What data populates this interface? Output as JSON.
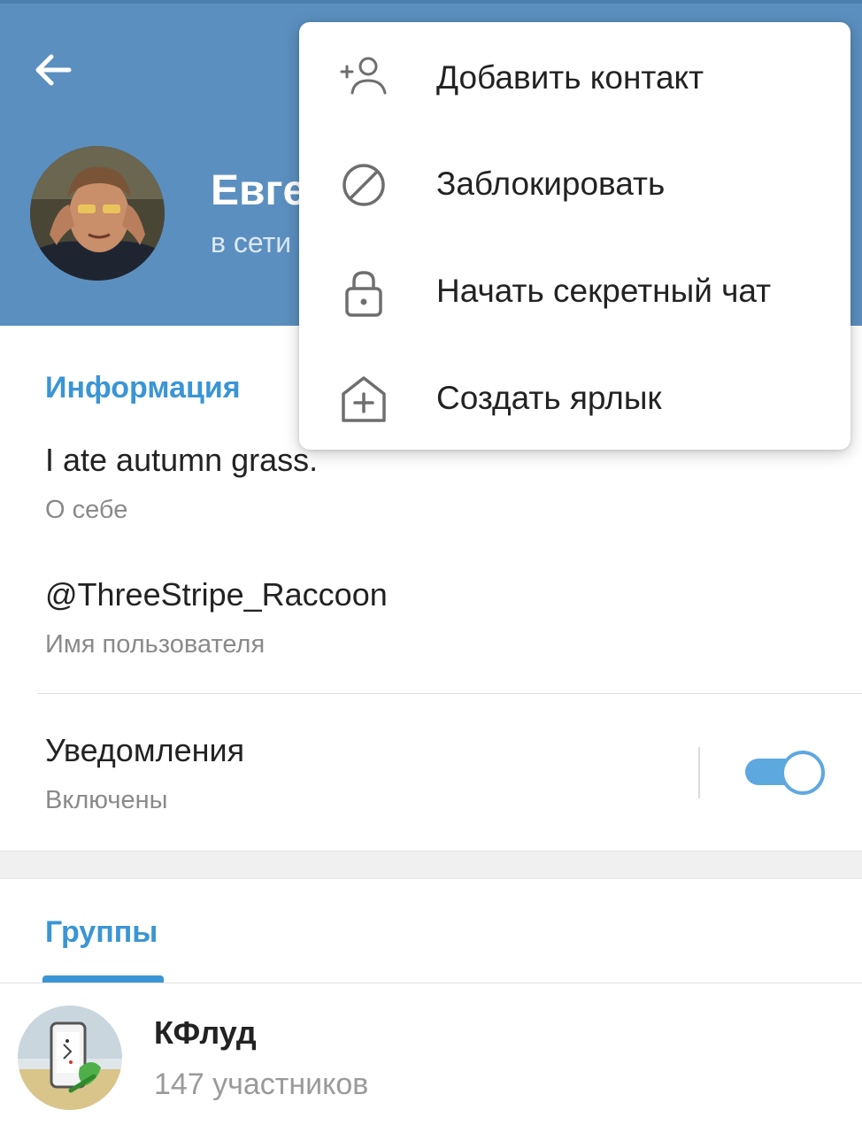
{
  "header": {
    "name": "Евге",
    "status": "в сети",
    "colors": {
      "header_bg": "#5b8fbf",
      "accent": "#3a95d5"
    }
  },
  "menu": {
    "items": [
      {
        "label": "Добавить контакт",
        "icon": "add-contact-icon"
      },
      {
        "label": "Заблокировать",
        "icon": "block-icon"
      },
      {
        "label": "Начать секретный чат",
        "icon": "lock-icon"
      },
      {
        "label": "Создать ярлык",
        "icon": "add-shortcut-icon"
      }
    ]
  },
  "info": {
    "title": "Информация",
    "bio": "I ate autumn grass.",
    "bio_label": "О себе",
    "username": "@ThreeStripe_Raccoon",
    "username_label": "Имя пользователя",
    "notifications_label": "Уведомления",
    "notifications_state": "Включены",
    "notifications_on": true
  },
  "groups": {
    "title": "Группы",
    "items": [
      {
        "name": "КФлуд",
        "members": "147 участников"
      }
    ]
  }
}
